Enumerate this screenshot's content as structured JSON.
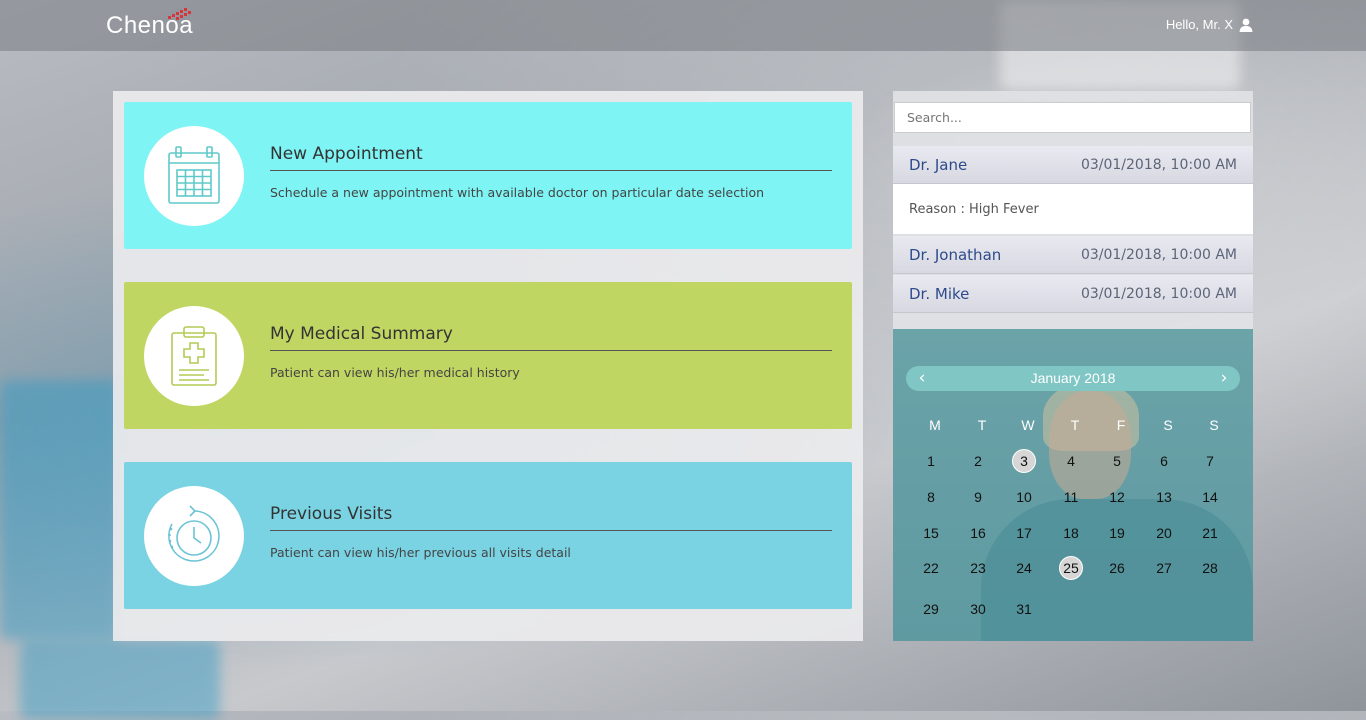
{
  "header": {
    "logo": "Chenoa",
    "greeting": "Hello, Mr. X",
    "user_icon": "user-icon"
  },
  "cards": [
    {
      "title": "New Appointment",
      "description": "Schedule a new appointment with available doctor on particular date selection",
      "icon": "calendar-icon",
      "color": "#7ef4f4"
    },
    {
      "title": "My Medical Summary",
      "description": "Patient can view his/her medical history",
      "icon": "clipboard-icon",
      "color": "#c0d663"
    },
    {
      "title": "Previous Visits",
      "description": "Patient can view his/her previous all visits detail",
      "icon": "clock-history-icon",
      "color": "#7ad3e3"
    }
  ],
  "search": {
    "placeholder": "Search..."
  },
  "appointments": [
    {
      "doctor": "Dr. Jane",
      "datetime": "03/01/2018, 10:00 AM",
      "reason": "Reason : High Fever"
    },
    {
      "doctor": "Dr. Jonathan",
      "datetime": "03/01/2018, 10:00 AM"
    },
    {
      "doctor": "Dr. Mike",
      "datetime": "03/01/2018, 10:00 AM"
    }
  ],
  "calendar": {
    "month": "January 2018",
    "prev_icon": "chevron-left-icon",
    "next_icon": "chevron-right-icon",
    "weekdays": [
      "M",
      "T",
      "W",
      "T",
      "F",
      "S",
      "S"
    ],
    "weeks": [
      [
        "1",
        "2",
        "3",
        "4",
        "5",
        "6",
        "7"
      ],
      [
        "8",
        "9",
        "10",
        "11",
        "12",
        "13",
        "14"
      ],
      [
        "15",
        "16",
        "17",
        "18",
        "19",
        "20",
        "21"
      ],
      [
        "22",
        "23",
        "24",
        "25",
        "26",
        "27",
        "28"
      ],
      [
        "29",
        "30",
        "31"
      ]
    ],
    "highlighted": [
      "3",
      "25"
    ]
  },
  "colors": {
    "accent_dark_blue": "#2d4b8a",
    "calendar_teal": "#6aa3a8",
    "calendar_header": "#7fc6c4"
  }
}
